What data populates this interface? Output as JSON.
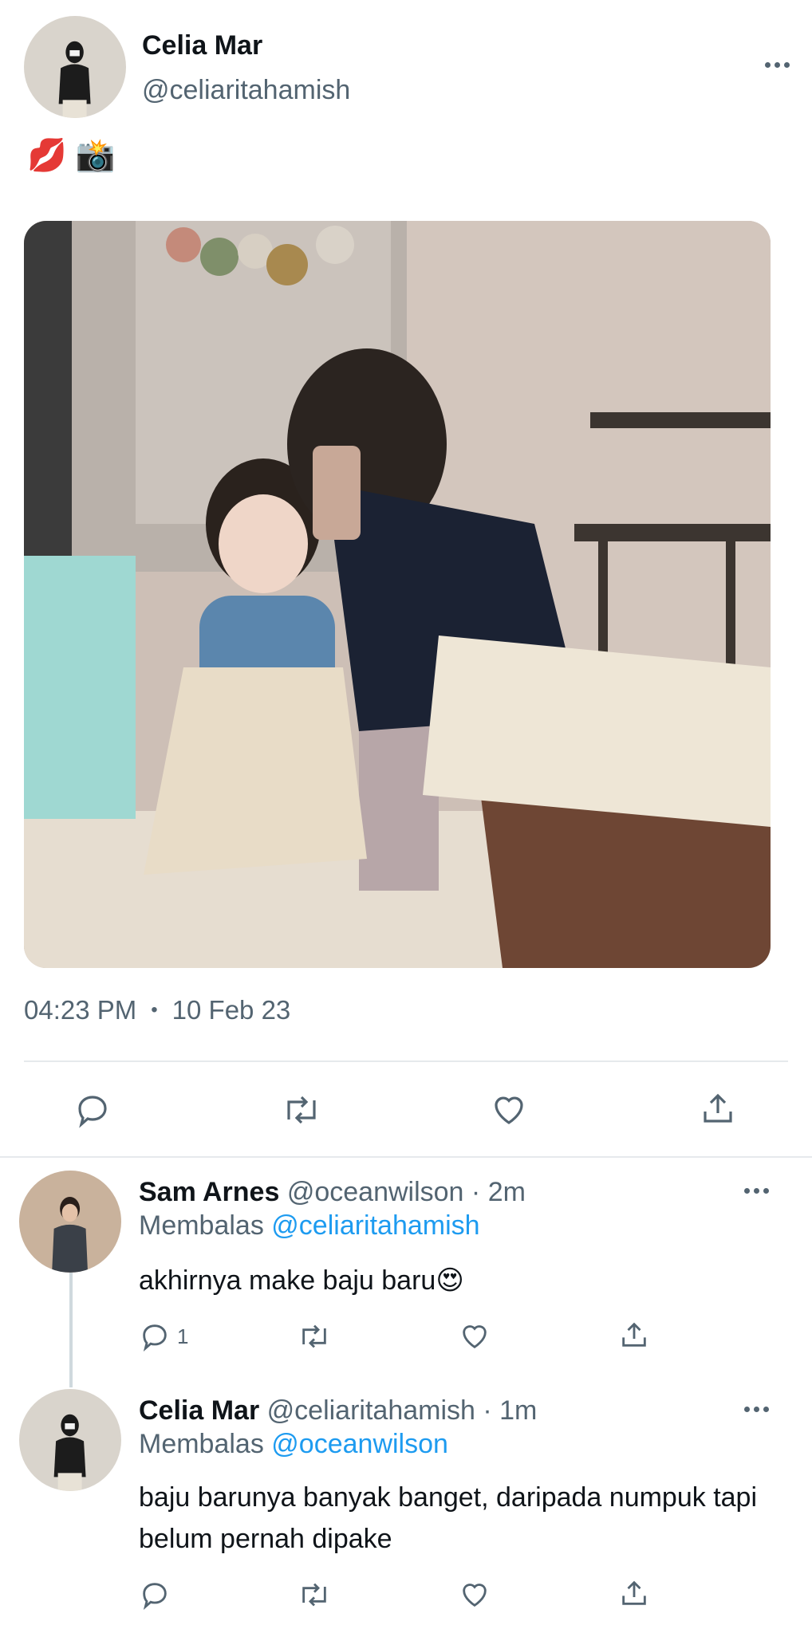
{
  "tweet": {
    "author_name": "Celia Mar",
    "author_handle": "@celiaritahamish",
    "text_emoji": "💋 📸",
    "time": "04:23 PM",
    "separator": "•",
    "date": "10 Feb 23"
  },
  "icons": {
    "more": "more-horizontal-icon",
    "reply": "reply-bubble-icon",
    "retweet": "retweet-icon",
    "like": "heart-icon",
    "share": "share-upload-icon"
  },
  "replies": [
    {
      "name": "Sam Arnes",
      "handle": "@oceanwilson",
      "time": "· 2m",
      "replying_prefix": "Membalas",
      "replying_to": "@celiaritahamish",
      "text": "akhirnya make baju baru😍",
      "reply_count": "1"
    },
    {
      "name": "Celia Mar",
      "handle": "@celiaritahamish",
      "time": "· 1m",
      "replying_prefix": "Membalas",
      "replying_to": "@oceanwilson",
      "text": "baju barunya banyak banget, daripada numpuk tapi belum pernah dipake",
      "reply_count": ""
    }
  ],
  "colors": {
    "text_primary": "#0f1419",
    "text_secondary": "#536471",
    "link": "#1d9bf0",
    "divider": "#e6e9ec"
  }
}
